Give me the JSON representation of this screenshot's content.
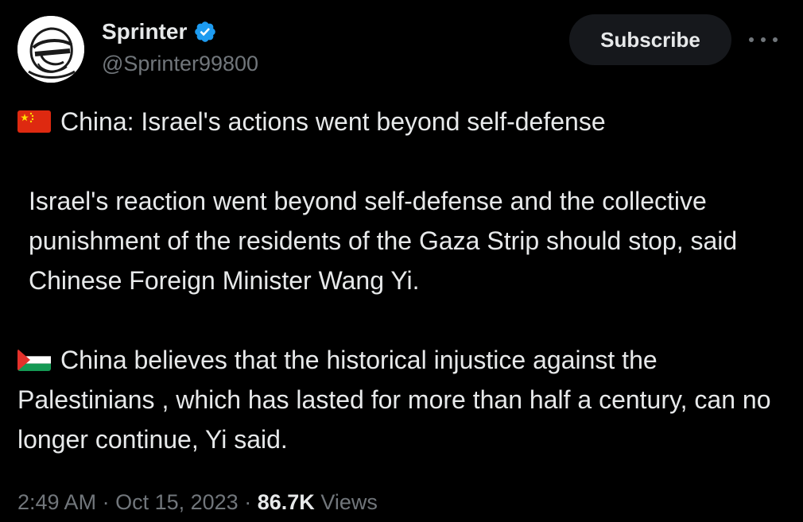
{
  "author": {
    "display_name": "Sprinter",
    "handle": "@Sprinter99800",
    "avatar_icon": "masked-face-sketch-icon",
    "verified_icon": "verified-badge-icon",
    "verified_color": "#1d9bf0"
  },
  "actions": {
    "subscribe_label": "Subscribe",
    "more_icon": "more-horizontal-icon"
  },
  "tweet": {
    "headline_flag_icon": "china-flag-icon",
    "headline": "China: Israel's actions went beyond self-defense",
    "paragraph_1": "Israel's reaction went beyond self-defense and the collective punishment of the residents of the Gaza Strip should stop, said Chinese Foreign Minister Wang Yi.",
    "paragraph_2_flag_icon": "palestine-flag-icon",
    "paragraph_2": "China believes that the historical injustice against the Palestinians , which has lasted for more than half a century, can no longer continue, Yi said."
  },
  "meta": {
    "time": "2:49 AM",
    "separator": "·",
    "date": "Oct 15, 2023",
    "views_count": "86.7K",
    "views_label": "Views"
  },
  "colors": {
    "background": "#000000",
    "text_primary": "#e7e9ea",
    "text_secondary": "#71767b",
    "button_background": "#16181c"
  }
}
